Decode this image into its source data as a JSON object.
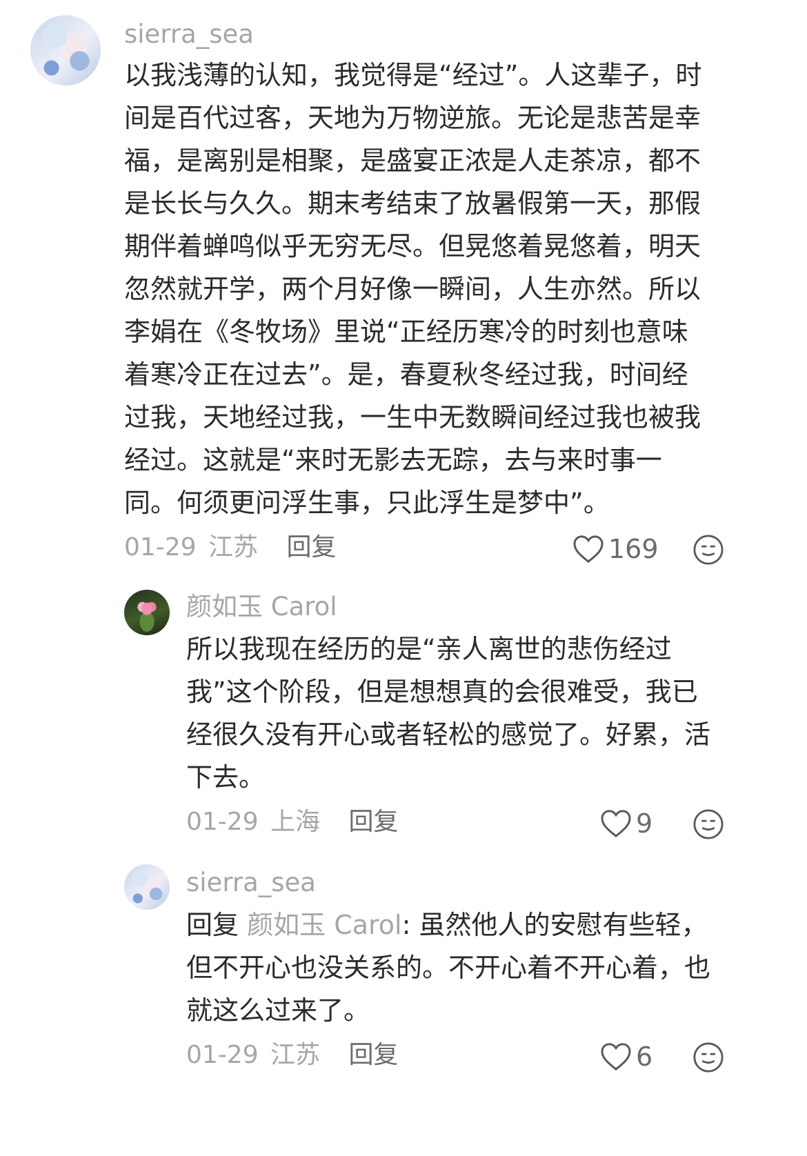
{
  "comments": [
    {
      "username": "sierra_sea",
      "lines": [
        "以我浅薄的认知，我觉得是“经过”。人这辈子，时",
        "间是百代过客，天地为万物逆旅。无论是悲苦是幸",
        "福，是离别是相聚，是盛宴正浓是人走茶凉，都不",
        "是长长与久久。期末考结束了放暑假第一天，那假",
        "期伴着蝉鸣似乎无穷无尽。但晃悠着晃悠着，明天",
        "忽然就开学，两个月好像一瞬间，人生亦然。所以",
        "李娟在《冬牧场》里说“正经历寒冷的时刻也意味",
        "着寒冷正在过去”。是，春夏秋冬经过我，时间经",
        "过我，天地经过我，一生中无数瞬间经过我也被我",
        "经过。这就是“来时无影去无踪，去与来时事一",
        "同。何须更问浮生事，只此浮生是梦中”。"
      ],
      "date": "01-29",
      "location": "江苏",
      "reply_label": "回复",
      "likes": "169"
    },
    {
      "username": "颜如玉 Carol",
      "lines": [
        "所以我现在经历的是“亲人离世的悲伤经过",
        "我”这个阶段，但是想想真的会很难受，我已",
        "经很久没有开心或者轻松的感觉了。好累，活",
        "下去。"
      ],
      "date": "01-29",
      "location": "上海",
      "reply_label": "回复",
      "likes": "9"
    },
    {
      "username": "sierra_sea",
      "reply_prefix": "回复",
      "reply_target": "颜如玉 Carol",
      "first_line_rest": ": 虽然他人的安慰有些轻，",
      "lines": [
        "但不开心也没关系的。不开心着不开心着，也",
        "就这么过来了。"
      ],
      "date": "01-29",
      "location": "江苏",
      "reply_label": "回复",
      "likes": "6"
    }
  ]
}
